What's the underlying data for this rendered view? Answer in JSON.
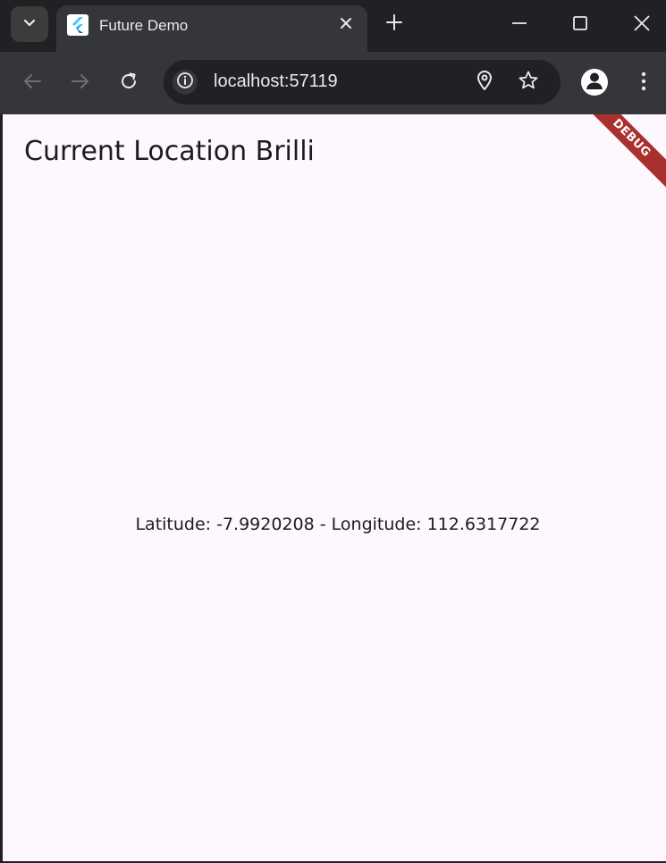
{
  "browser": {
    "tab": {
      "title": "Future Demo",
      "favicon": "flutter-logo-icon"
    },
    "tab_search_icon": "chevron-down-icon",
    "new_tab_icon": "plus-icon",
    "window_controls": [
      "minimize-icon",
      "maximize-icon",
      "close-icon"
    ],
    "nav": [
      "back-arrow-icon",
      "forward-arrow-icon",
      "reload-icon"
    ],
    "omnibox": {
      "url": "localhost:57119",
      "site_info_icon": "info-icon",
      "location_icon": "location-pin-icon",
      "bookmark_icon": "star-icon"
    },
    "profile_icon": "profile-icon",
    "menu_icon": "kebab-menu-icon"
  },
  "app": {
    "title": "Current Location Brilli",
    "location_text": "Latitude: -7.9920208 - Longitude: 112.6317722",
    "debug_banner": "DEBUG"
  },
  "colors": {
    "page_background": "#fdf7fe",
    "chrome_dark": "#202124",
    "toolbar": "#35363a",
    "debug_banner": "#a8302d"
  }
}
